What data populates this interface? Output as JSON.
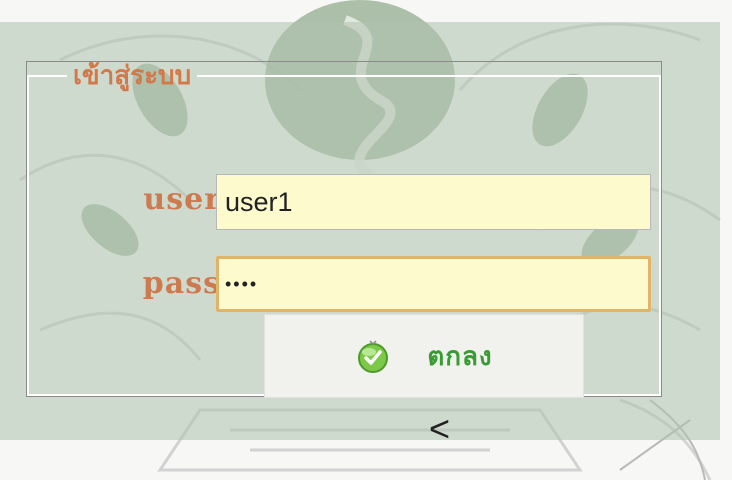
{
  "login": {
    "legend": "เข้าสู่ระบบ",
    "user_label": "user",
    "user_value": "user1",
    "pass_label": "pass",
    "pass_value": "••••",
    "submit_label": "ตกลง",
    "extra_glyph": "<"
  },
  "colors": {
    "label": "#cc7a4e",
    "legend": "#d2794a",
    "input_bg": "#fdfacd",
    "focus_border": "#e1b469",
    "button_text": "#3a9a33"
  },
  "icons": {
    "submit_icon": "green-check-icon"
  }
}
